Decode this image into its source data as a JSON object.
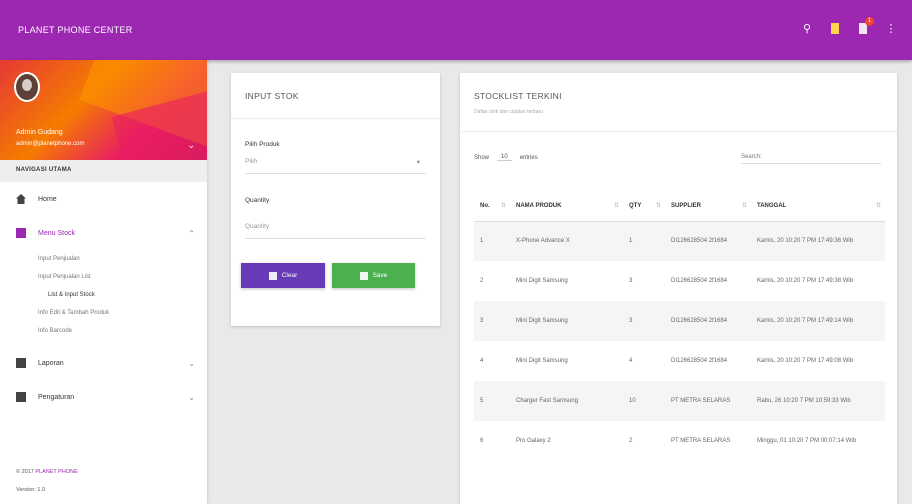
{
  "topbar": {
    "brand": "PLANET PHONE CENTER",
    "icons": [
      "search-icon",
      "notes-icon",
      "flag-icon",
      "more-vert-icon"
    ],
    "badge": "1"
  },
  "sidebar": {
    "user_name": "Admin Gudang",
    "user_email": "admin@planetphone.com",
    "nav_header": "NAVIGASI UTAMA",
    "items": [
      {
        "label": "Home",
        "icon": "home-icon"
      },
      {
        "label": "Menu Stock",
        "icon": "widgets-icon"
      }
    ],
    "subitems": [
      "Input Penjualan",
      "Input Penjualan List",
      "List & Input Stock",
      "Info Edit & Tambah Produk",
      "Info Barcode"
    ],
    "items2": [
      {
        "label": "Laporan",
        "icon": "report-icon"
      },
      {
        "label": "Pengaturan",
        "icon": "settings-icon"
      }
    ],
    "footer_line1_prefix": "© 2017 ",
    "footer_line1_link": "PLANET PHONE",
    "footer_line2": "Version: 1.0"
  },
  "input_card": {
    "title": "INPUT STOK",
    "product_label": "Pilih Produk",
    "product_value": "Pilih",
    "quantity_label": "Quantity",
    "quantity_placeholder": "Quantity",
    "clear_label": "Clear",
    "save_label": "Save"
  },
  "list_card": {
    "title": "STOCKLIST TERKINI",
    "subtitle": "Daftar stok dan catatan terbaru",
    "show_label": "Show",
    "show_value": "10",
    "entries_label": "entries",
    "search_label": "Search:",
    "headers": [
      "No.",
      "NAMA PRODUK",
      "QTY",
      "SUPPLIER",
      "TANGGAL"
    ],
    "rows": [
      {
        "no": "1",
        "produk": "X-Phone Advance X",
        "qty": "1",
        "supplier": "DI126628504 2f1684",
        "tanggal": "Kamis, 20 10:20 7 PM 17:49:36 Wib"
      },
      {
        "no": "2",
        "produk": "Mini Digit Samsung",
        "qty": "3",
        "supplier": "DI126628504 2f1684",
        "tanggal": "Kamis, 20 10:20 7 PM 17:49:38 Wib"
      },
      {
        "no": "3",
        "produk": "Mini Digit Samsung",
        "qty": "3",
        "supplier": "DI126628504 2f1684",
        "tanggal": "Kamis, 20 10:20 7 PM 17:49:14 Wib"
      },
      {
        "no": "4",
        "produk": "Mini Digit Samsung",
        "qty": "4",
        "supplier": "DI126628504 2f1684",
        "tanggal": "Kamis, 20 10:20 7 PM 17:49:08 Wib"
      },
      {
        "no": "5",
        "produk": "Charger Fast Samsung",
        "qty": "10",
        "supplier": "PT METRA SELARAS",
        "tanggal": "Rabu, 26 10:20 7 PM 10:59:33 Wib"
      },
      {
        "no": "6",
        "produk": "Pro Galaxy 2",
        "qty": "2",
        "supplier": "PT METRA SELARAS",
        "tanggal": "Minggu, 01 10:20 7 PM 00:07:14 Wib"
      }
    ]
  },
  "colors": {
    "primary": "#9c27b0",
    "clear": "#673ab7",
    "save": "#4caf50"
  }
}
